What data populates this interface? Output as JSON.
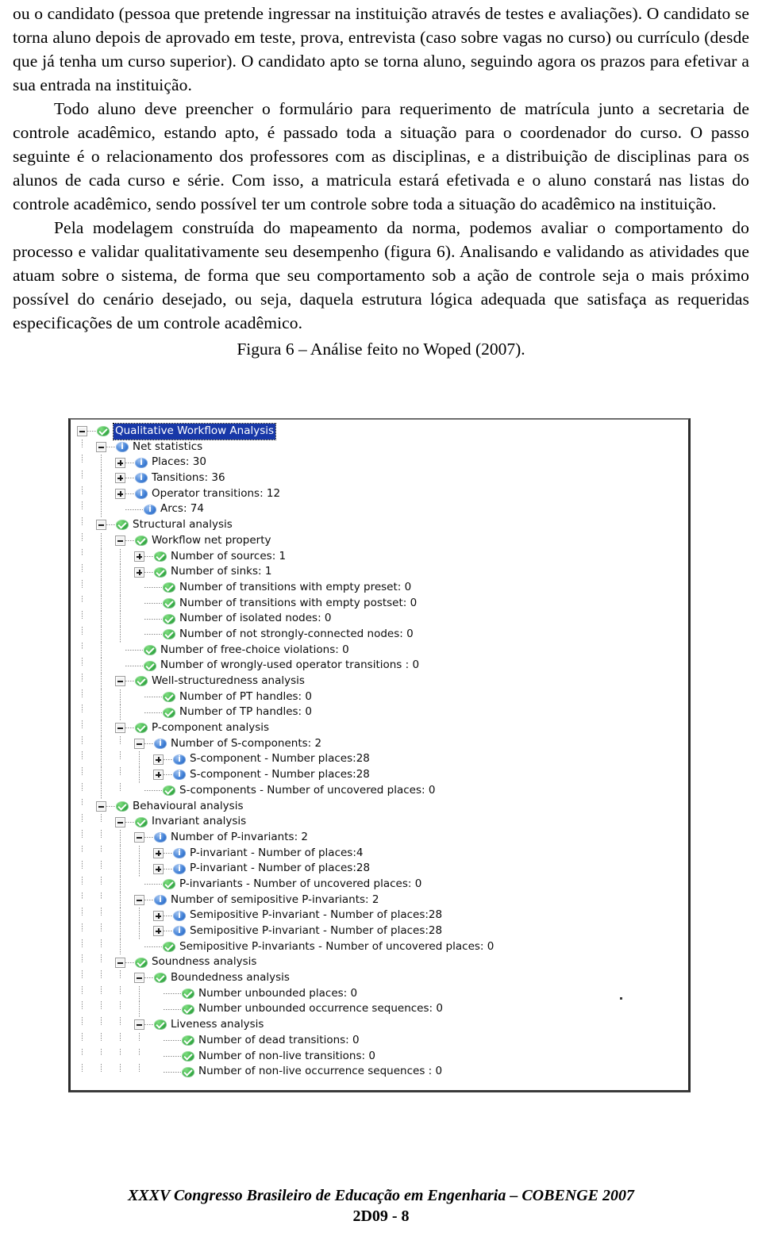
{
  "document": {
    "paragraphs": [
      "ou o candidato (pessoa que pretende ingressar na instituição através de testes e avaliações). O candidato se torna aluno depois de aprovado em teste, prova, entrevista (caso sobre vagas no curso) ou currículo (desde que já tenha um curso superior). O candidato apto se torna aluno, seguindo agora os prazos para efetivar a sua entrada na instituição.",
      "Todo aluno deve preencher o formulário para requerimento de matrícula junto a secretaria de controle acadêmico, estando apto, é passado toda a situação para o coordenador do curso. O passo seguinte é o relacionamento dos professores com as disciplinas, e a distribuição de disciplinas para os alunos de cada curso e série. Com isso, a matricula estará efetivada e o aluno constará nas listas do controle acadêmico, sendo possível ter um controle sobre toda a situação do acadêmico na instituição.",
      "Pela modelagem construída do mapeamento da norma, podemos avaliar o comportamento do processo e validar qualitativamente seu desempenho (figura 6). Analisando e validando as atividades que atuam sobre o sistema, de forma que seu comportamento sob a ação de controle seja o mais próximo possível do cenário desejado, ou seja, daquela estrutura lógica adequada que satisfaça as requeridas especificações de um controle acadêmico."
    ],
    "figure_caption": "Figura 6 – Análise feito no Woped (2007)."
  },
  "footer": {
    "line1": "XXXV Congresso Brasileiro de Educação em Engenharia – COBENGE 2007",
    "line2": "2D09 - 8"
  },
  "colors": {
    "selection": "#1838a8",
    "ok_icon": "#3cb14a",
    "info_icon": "#3f7fd6",
    "frame": "#2b2b2b"
  },
  "figure": {
    "app": "Woped Qualitative Workflow Analysis",
    "tree": [
      {
        "indent": 0,
        "expander": "minus",
        "icon": "ok",
        "label": "Qualitative Workflow Analysis",
        "selected": true
      },
      {
        "indent": 1,
        "expander": "minus",
        "icon": "info",
        "label": "Net statistics"
      },
      {
        "indent": 2,
        "expander": "plus",
        "icon": "info",
        "label": "Places: 30"
      },
      {
        "indent": 2,
        "expander": "plus",
        "icon": "info",
        "label": "Tansitions: 36"
      },
      {
        "indent": 2,
        "expander": "plus",
        "icon": "info",
        "label": "Operator transitions: 12"
      },
      {
        "indent": 2,
        "expander": "none",
        "icon": "info",
        "label": "Arcs: 74"
      },
      {
        "indent": 1,
        "expander": "minus",
        "icon": "ok",
        "label": "Structural analysis"
      },
      {
        "indent": 2,
        "expander": "minus",
        "icon": "ok",
        "label": "Workflow net property"
      },
      {
        "indent": 3,
        "expander": "plus",
        "icon": "ok",
        "label": "Number of sources: 1"
      },
      {
        "indent": 3,
        "expander": "plus",
        "icon": "ok",
        "label": "Number of sinks: 1"
      },
      {
        "indent": 3,
        "expander": "none",
        "icon": "ok",
        "label": "Number of transitions with empty preset: 0"
      },
      {
        "indent": 3,
        "expander": "none",
        "icon": "ok",
        "label": "Number of transitions with empty postset: 0"
      },
      {
        "indent": 3,
        "expander": "none",
        "icon": "ok",
        "label": "Number of isolated nodes: 0"
      },
      {
        "indent": 3,
        "expander": "none",
        "icon": "ok",
        "label": "Number of not strongly-connected nodes: 0"
      },
      {
        "indent": 2,
        "expander": "none",
        "icon": "ok",
        "label": "Number of free-choice violations: 0"
      },
      {
        "indent": 2,
        "expander": "none",
        "icon": "ok",
        "label": "Number of wrongly-used operator transitions : 0"
      },
      {
        "indent": 2,
        "expander": "minus",
        "icon": "ok",
        "label": "Well-structuredness analysis"
      },
      {
        "indent": 3,
        "expander": "none",
        "icon": "ok",
        "label": "Number of PT handles: 0"
      },
      {
        "indent": 3,
        "expander": "none",
        "icon": "ok",
        "label": "Number of TP handles: 0"
      },
      {
        "indent": 2,
        "expander": "minus",
        "icon": "ok",
        "label": "P-component analysis"
      },
      {
        "indent": 3,
        "expander": "minus",
        "icon": "info",
        "label": "Number of S-components: 2"
      },
      {
        "indent": 4,
        "expander": "plus",
        "icon": "info",
        "label": "S-component - Number places:28"
      },
      {
        "indent": 4,
        "expander": "plus",
        "icon": "info",
        "label": "S-component - Number places:28"
      },
      {
        "indent": 3,
        "expander": "none",
        "icon": "ok",
        "label": "S-components - Number of uncovered places: 0"
      },
      {
        "indent": 1,
        "expander": "minus",
        "icon": "ok",
        "label": "Behavioural analysis"
      },
      {
        "indent": 2,
        "expander": "minus",
        "icon": "ok",
        "label": "Invariant analysis"
      },
      {
        "indent": 3,
        "expander": "minus",
        "icon": "info",
        "label": "Number of P-invariants: 2"
      },
      {
        "indent": 4,
        "expander": "plus",
        "icon": "info",
        "label": "P-invariant - Number of places:4"
      },
      {
        "indent": 4,
        "expander": "plus",
        "icon": "info",
        "label": "P-invariant - Number of places:28"
      },
      {
        "indent": 3,
        "expander": "none",
        "icon": "ok",
        "label": "P-invariants - Number of uncovered places: 0"
      },
      {
        "indent": 3,
        "expander": "minus",
        "icon": "info",
        "label": "Number of semipositive P-invariants: 2"
      },
      {
        "indent": 4,
        "expander": "plus",
        "icon": "info",
        "label": "Semipositive P-invariant - Number of places:28"
      },
      {
        "indent": 4,
        "expander": "plus",
        "icon": "info",
        "label": "Semipositive P-invariant - Number of places:28"
      },
      {
        "indent": 3,
        "expander": "none",
        "icon": "ok",
        "label": "Semipositive P-invariants - Number of uncovered places: 0"
      },
      {
        "indent": 2,
        "expander": "minus",
        "icon": "ok",
        "label": "Soundness analysis"
      },
      {
        "indent": 3,
        "expander": "minus",
        "icon": "ok",
        "label": "Boundedness analysis"
      },
      {
        "indent": 4,
        "expander": "none",
        "icon": "ok",
        "label": "Number unbounded places: 0"
      },
      {
        "indent": 4,
        "expander": "none",
        "icon": "ok",
        "label": "Number unbounded occurrence sequences: 0"
      },
      {
        "indent": 3,
        "expander": "minus",
        "icon": "ok",
        "label": "Liveness analysis"
      },
      {
        "indent": 4,
        "expander": "none",
        "icon": "ok",
        "label": "Number of dead transitions: 0"
      },
      {
        "indent": 4,
        "expander": "none",
        "icon": "ok",
        "label": "Number of non-live transitions: 0"
      },
      {
        "indent": 4,
        "expander": "none",
        "icon": "ok",
        "label": "Number of non-live occurrence sequences : 0"
      }
    ]
  }
}
